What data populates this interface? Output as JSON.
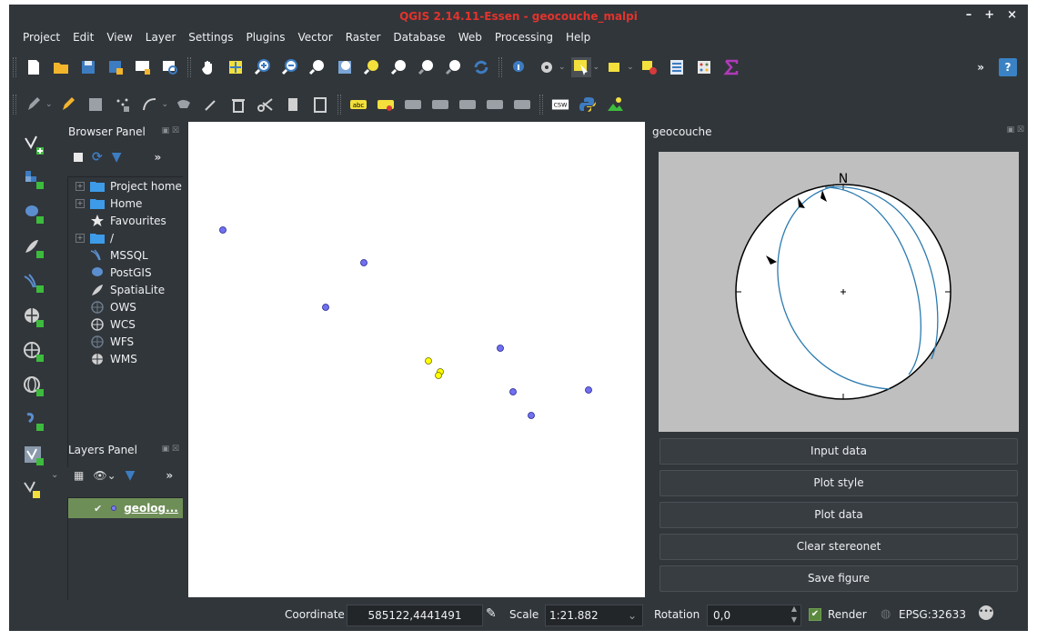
{
  "window": {
    "title": "QGIS 2.14.11-Essen - geocouche_malpi",
    "controls": [
      "–",
      "+",
      "×"
    ]
  },
  "menubar": {
    "items": [
      "Project",
      "Edit",
      "View",
      "Layer",
      "Settings",
      "Plugins",
      "Vector",
      "Raster",
      "Database",
      "Web",
      "Processing",
      "Help"
    ]
  },
  "toolbar": {
    "more": "»",
    "help": "?",
    "label_tools": [
      "abc",
      "abc",
      "abc",
      "abc",
      "abc",
      "abc",
      "abc"
    ],
    "csv": "CSW"
  },
  "browser_panel": {
    "title": "Browser Panel",
    "more": "»",
    "items": [
      {
        "label": "Project home",
        "icon": "folder-icon",
        "expandable": true
      },
      {
        "label": "Home",
        "icon": "folder-icon",
        "expandable": true
      },
      {
        "label": "Favourites",
        "icon": "star-icon",
        "expandable": false
      },
      {
        "label": "/",
        "icon": "folder-icon",
        "expandable": true
      },
      {
        "label": "MSSQL",
        "icon": "mssql-icon",
        "expandable": false
      },
      {
        "label": "PostGIS",
        "icon": "postgis-icon",
        "expandable": false
      },
      {
        "label": "SpatiaLite",
        "icon": "spatialite-icon",
        "expandable": false
      },
      {
        "label": "OWS",
        "icon": "globe-icon",
        "expandable": false
      },
      {
        "label": "WCS",
        "icon": "wcs-icon",
        "expandable": false
      },
      {
        "label": "WFS",
        "icon": "globe-icon",
        "expandable": false
      },
      {
        "label": "WMS",
        "icon": "wms-icon",
        "expandable": false
      }
    ]
  },
  "layers_panel": {
    "title": "Layers Panel",
    "more": "»",
    "layer": {
      "name": "geolog...",
      "checked": true,
      "point_color": "#7f7ff0"
    }
  },
  "map": {
    "points": [
      {
        "color": "#7070f0"
      },
      {
        "color": "#7070f0"
      },
      {
        "color": "#7070f0"
      },
      {
        "color": "#7070f0"
      },
      {
        "color": "#7070f0"
      },
      {
        "color": "#7070f0"
      },
      {
        "color": "#7070f0"
      },
      {
        "color": "#ffff00"
      },
      {
        "color": "#ffff00"
      },
      {
        "color": "#ffff00"
      }
    ]
  },
  "geocouche": {
    "title": "geocouche",
    "north": "N",
    "plane_color": "#2b7bb0",
    "buttons": [
      "Input data",
      "Plot style",
      "Plot data",
      "Clear stereonet",
      "Save figure"
    ]
  },
  "statusbar": {
    "coordinate_label": "Coordinate",
    "coordinate_value": "585122,4441491",
    "scale_label": "Scale",
    "scale_value": "1:21.882",
    "rotation_label": "Rotation",
    "rotation_value": "0,0",
    "render_label": "Render",
    "render_checked": true,
    "crs": "EPSG:32633"
  },
  "colors": {
    "ui_bg": "#31363b",
    "layer_highlight": "#6e8e57",
    "title_accent": "#e3332c"
  }
}
